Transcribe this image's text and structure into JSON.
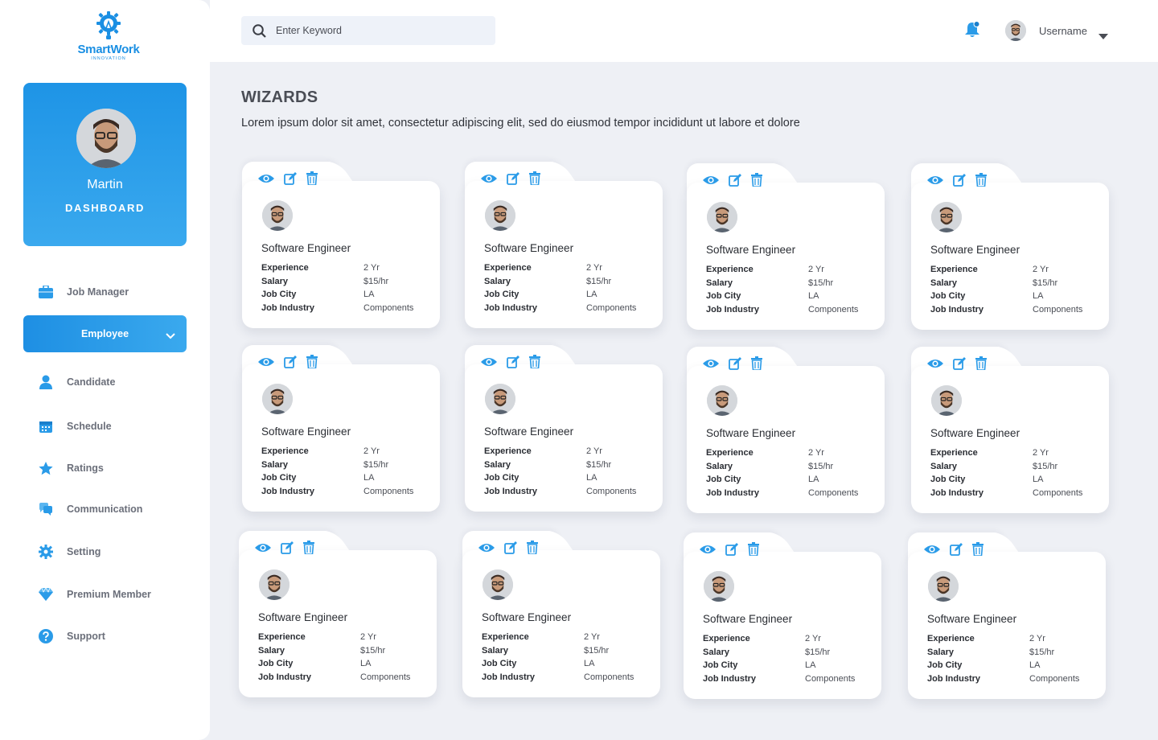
{
  "brand": {
    "name": "SmartWork",
    "tagline": "INNOVATION",
    "accent": "#1a8fe3"
  },
  "profile": {
    "name": "Martin",
    "role": "DASHBOARD"
  },
  "nav": [
    {
      "label": "Job Manager",
      "icon": "briefcase-icon"
    },
    {
      "label": "Employee",
      "icon": "chevron-down-icon",
      "active": true
    },
    {
      "label": "Candidate",
      "icon": "user-icon"
    },
    {
      "label": "Schedule",
      "icon": "calendar-icon"
    },
    {
      "label": "Ratings",
      "icon": "star-icon"
    },
    {
      "label": "Communication",
      "icon": "chat-icon"
    },
    {
      "label": "Setting",
      "icon": "gear-icon"
    },
    {
      "label": "Premium Member",
      "icon": "diamond-icon"
    },
    {
      "label": "Support",
      "icon": "help-icon"
    }
  ],
  "topbar": {
    "search_placeholder": "Enter Keyword",
    "username": "Username"
  },
  "page": {
    "title": "WIZARDS",
    "description": "Lorem ipsum dolor sit amet, consectetur adipiscing elit, sed do eiusmod tempor incididunt ut labore et dolore"
  },
  "cards": [
    {
      "title": "Software Engineer",
      "rows": [
        [
          "Experience",
          "2 Yr"
        ],
        [
          "Salary",
          "$15/hr"
        ],
        [
          "Job City",
          "LA"
        ],
        [
          "Job Industry",
          "Components"
        ]
      ]
    },
    {
      "title": "Software Engineer",
      "rows": [
        [
          "Experience",
          "2 Yr"
        ],
        [
          "Salary",
          "$15/hr"
        ],
        [
          "Job City",
          "LA"
        ],
        [
          "Job Industry",
          "Components"
        ]
      ]
    },
    {
      "title": "Software Engineer",
      "rows": [
        [
          "Experience",
          "2 Yr"
        ],
        [
          "Salary",
          "$15/hr"
        ],
        [
          "Job City",
          "LA"
        ],
        [
          "Job Industry",
          "Components"
        ]
      ]
    },
    {
      "title": "Software Engineer",
      "rows": [
        [
          "Experience",
          "2 Yr"
        ],
        [
          "Salary",
          "$15/hr"
        ],
        [
          "Job City",
          "LA"
        ],
        [
          "Job Industry",
          "Components"
        ]
      ]
    },
    {
      "title": "Software Engineer",
      "rows": [
        [
          "Experience",
          "2 Yr"
        ],
        [
          "Salary",
          "$15/hr"
        ],
        [
          "Job City",
          "LA"
        ],
        [
          "Job Industry",
          "Components"
        ]
      ]
    },
    {
      "title": "Software Engineer",
      "rows": [
        [
          "Experience",
          "2 Yr"
        ],
        [
          "Salary",
          "$15/hr"
        ],
        [
          "Job City",
          "LA"
        ],
        [
          "Job Industry",
          "Components"
        ]
      ]
    },
    {
      "title": "Software Engineer",
      "rows": [
        [
          "Experience",
          "2 Yr"
        ],
        [
          "Salary",
          "$15/hr"
        ],
        [
          "Job City",
          "LA"
        ],
        [
          "Job Industry",
          "Components"
        ]
      ]
    },
    {
      "title": "Software Engineer",
      "rows": [
        [
          "Experience",
          "2 Yr"
        ],
        [
          "Salary",
          "$15/hr"
        ],
        [
          "Job City",
          "LA"
        ],
        [
          "Job Industry",
          "Components"
        ]
      ]
    },
    {
      "title": "Software Engineer",
      "rows": [
        [
          "Experience",
          "2 Yr"
        ],
        [
          "Salary",
          "$15/hr"
        ],
        [
          "Job City",
          "LA"
        ],
        [
          "Job Industry",
          "Components"
        ]
      ]
    },
    {
      "title": "Software Engineer",
      "rows": [
        [
          "Experience",
          "2 Yr"
        ],
        [
          "Salary",
          "$15/hr"
        ],
        [
          "Job City",
          "LA"
        ],
        [
          "Job Industry",
          "Components"
        ]
      ]
    },
    {
      "title": "Software Engineer",
      "rows": [
        [
          "Experience",
          "2 Yr"
        ],
        [
          "Salary",
          "$15/hr"
        ],
        [
          "Job City",
          "LA"
        ],
        [
          "Job Industry",
          "Components"
        ]
      ]
    },
    {
      "title": "Software Engineer",
      "rows": [
        [
          "Experience",
          "2 Yr"
        ],
        [
          "Salary",
          "$15/hr"
        ],
        [
          "Job City",
          "LA"
        ],
        [
          "Job Industry",
          "Components"
        ]
      ]
    }
  ]
}
